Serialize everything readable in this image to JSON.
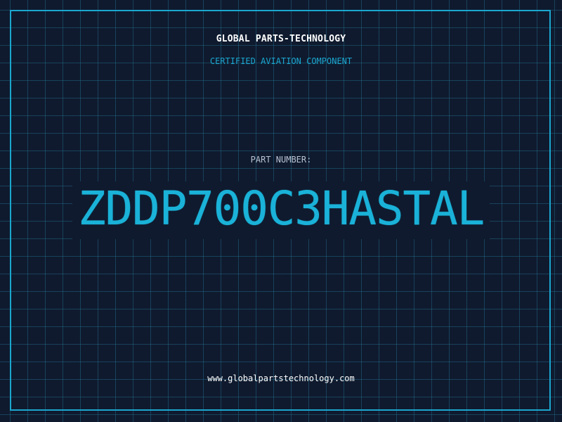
{
  "header": {
    "brand": "GLOBAL PARTS-TECHNOLOGY",
    "subtitle": "CERTIFIED AVIATION COMPONENT"
  },
  "part": {
    "label": "PART NUMBER:",
    "number": "ZDDP700C3HASTAL"
  },
  "footer": {
    "url": "www.globalpartstechnology.com"
  },
  "colors": {
    "background": "#0f1a2e",
    "grid": "#2682a0",
    "accent": "#1ba6cf",
    "text": "#ffffff",
    "muted": "#b8c2d2"
  }
}
